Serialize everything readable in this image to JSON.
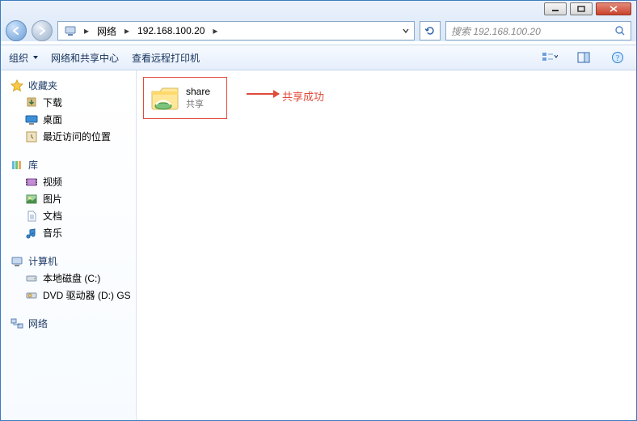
{
  "titlebar": {
    "minimize": "−",
    "maximize": "□",
    "close": "×"
  },
  "breadcrumb": {
    "seg1": "网络",
    "seg2": "192.168.100.20"
  },
  "search": {
    "placeholder": "搜索 192.168.100.20"
  },
  "toolbar": {
    "organize": "组织",
    "network_center": "网络和共享中心",
    "remote_printers": "查看远程打印机"
  },
  "sidebar": {
    "favorites": {
      "label": "收藏夹",
      "items": [
        "下载",
        "桌面",
        "最近访问的位置"
      ]
    },
    "libraries": {
      "label": "库",
      "items": [
        "视频",
        "图片",
        "文档",
        "音乐"
      ]
    },
    "computer": {
      "label": "计算机",
      "items": [
        "本地磁盘 (C:)",
        "DVD 驱动器 (D:) GS"
      ]
    },
    "network": {
      "label": "网络"
    }
  },
  "content": {
    "folder": {
      "name": "share",
      "subtitle": "共享"
    },
    "annotation": "共享成功"
  }
}
